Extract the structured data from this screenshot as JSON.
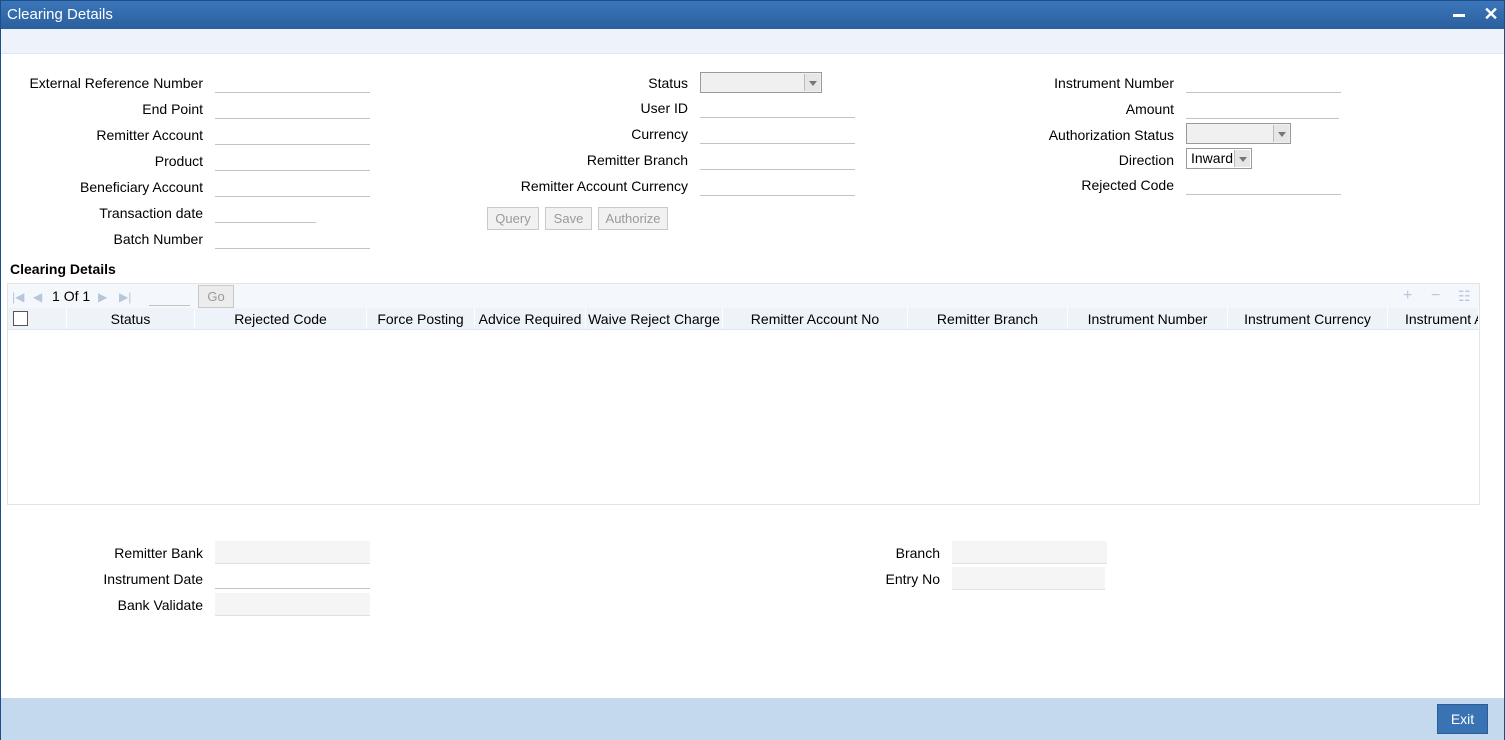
{
  "window": {
    "title": "Clearing Details"
  },
  "form": {
    "left": [
      {
        "label": "External Reference Number",
        "value": ""
      },
      {
        "label": "End Point",
        "value": ""
      },
      {
        "label": "Remitter Account",
        "value": ""
      },
      {
        "label": "Product",
        "value": ""
      },
      {
        "label": "Beneficiary Account",
        "value": ""
      },
      {
        "label": "Transaction date",
        "value": ""
      },
      {
        "label": "Batch Number",
        "value": ""
      }
    ],
    "middle": [
      {
        "label": "Status",
        "value": ""
      },
      {
        "label": "User ID",
        "value": ""
      },
      {
        "label": "Currency",
        "value": ""
      },
      {
        "label": "Remitter Branch",
        "value": ""
      },
      {
        "label": "Remitter Account Currency",
        "value": ""
      }
    ],
    "right": [
      {
        "label": "Instrument Number",
        "value": ""
      },
      {
        "label": "Amount",
        "value": ""
      },
      {
        "label": "Authorization Status",
        "value": ""
      },
      {
        "label": "Direction",
        "value": "Inward"
      },
      {
        "label": "Rejected Code",
        "value": ""
      }
    ],
    "buttons": {
      "query": "Query",
      "save": "Save",
      "authorize": "Authorize"
    }
  },
  "grid": {
    "title": "Clearing Details",
    "pagination": {
      "current": "1",
      "of_label": "Of",
      "total": "1",
      "go_label": "Go"
    },
    "columns": [
      "Status",
      "Rejected Code",
      "Force Posting",
      "Advice Required",
      "Waive Reject Charge",
      "Remitter Account No",
      "Remitter Branch",
      "Instrument Number",
      "Instrument Currency",
      "Instrument A"
    ]
  },
  "bottom": {
    "left": [
      {
        "label": "Remitter Bank",
        "value": ""
      },
      {
        "label": "Instrument Date",
        "value": ""
      },
      {
        "label": "Bank Validate",
        "value": ""
      }
    ],
    "right": [
      {
        "label": "Branch",
        "value": ""
      },
      {
        "label": "Entry No",
        "value": ""
      }
    ]
  },
  "footer": {
    "exit_label": "Exit"
  }
}
